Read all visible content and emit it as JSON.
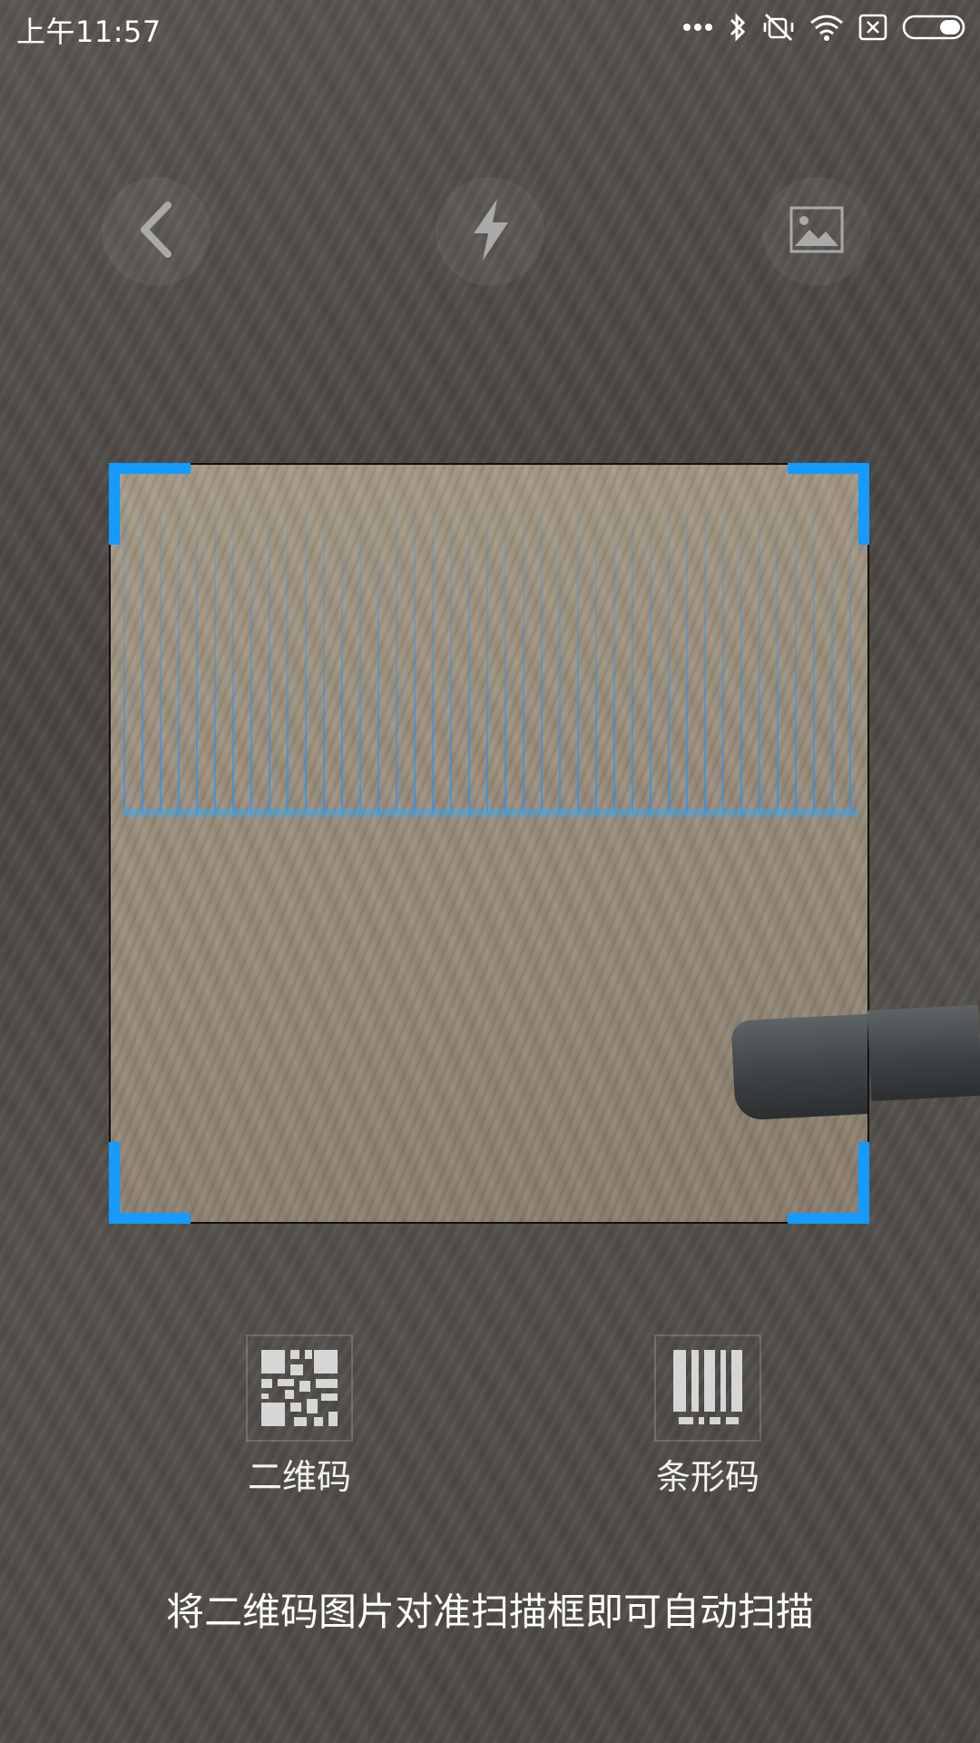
{
  "status_bar": {
    "time": "上午11:57",
    "icons": [
      "more-dots-icon",
      "bluetooth-icon",
      "vibrate-off-icon",
      "wifi-icon",
      "no-sim-icon",
      "battery-icon"
    ]
  },
  "toolbar": {
    "back_icon": "chevron-left-icon",
    "flash_icon": "flash-icon",
    "gallery_icon": "image-icon"
  },
  "modes": {
    "qr_label": "二维码",
    "barcode_label": "条形码"
  },
  "hint_text": "将二维码图片对准扫描框即可自动扫描",
  "colors": {
    "accent": "#139bff",
    "text": "#ffffff"
  }
}
